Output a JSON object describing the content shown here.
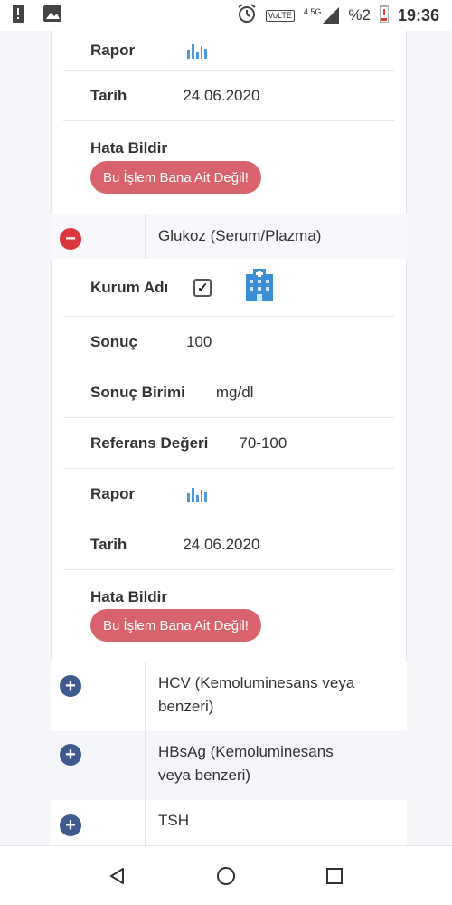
{
  "status_bar": {
    "left_icons": [
      "alert-icon",
      "image-icon"
    ],
    "network": "4.5G",
    "volte": "VoLTE",
    "battery_percent": "%2",
    "time": "19:36"
  },
  "upper_block": {
    "rapor_label": "Rapor",
    "tarih_label": "Tarih",
    "tarih_value": "24.06.2020",
    "hata_label": "Hata Bildir",
    "hata_button": "Bu İşlem Bana Ait Değil!"
  },
  "glukoz": {
    "name": "Glukoz (Serum/Plazma)",
    "toggle": "−",
    "kurum_label": "Kurum Adı",
    "kurum_checked": true,
    "sonuc_label": "Sonuç",
    "sonuc_value": "100",
    "birim_label": "Sonuç Birimi",
    "birim_value": "mg/dl",
    "referans_label": "Referans Değeri",
    "referans_value": "70-100",
    "rapor_label": "Rapor",
    "tarih_label": "Tarih",
    "tarih_value": "24.06.2020",
    "hata_label": "Hata Bildir",
    "hata_button": "Bu İşlem Bana Ait Değil!"
  },
  "tests": [
    {
      "name_line1": "HCV (Kemoluminesans veya",
      "name_line2": "benzeri)",
      "toggle": "+"
    },
    {
      "name_line1": "HBsAg (Kemoluminesans",
      "name_line2": "veya benzeri)",
      "toggle": "+"
    },
    {
      "name_line1": "TSH",
      "name_line2": "",
      "toggle": "+"
    }
  ],
  "colors": {
    "error_button": "#d9636c",
    "minus_circle": "#d9363e",
    "plus_circle": "#3f5b8e",
    "chart_icon": "#4f9bd9",
    "hospital_icon": "#3a8fd6"
  }
}
